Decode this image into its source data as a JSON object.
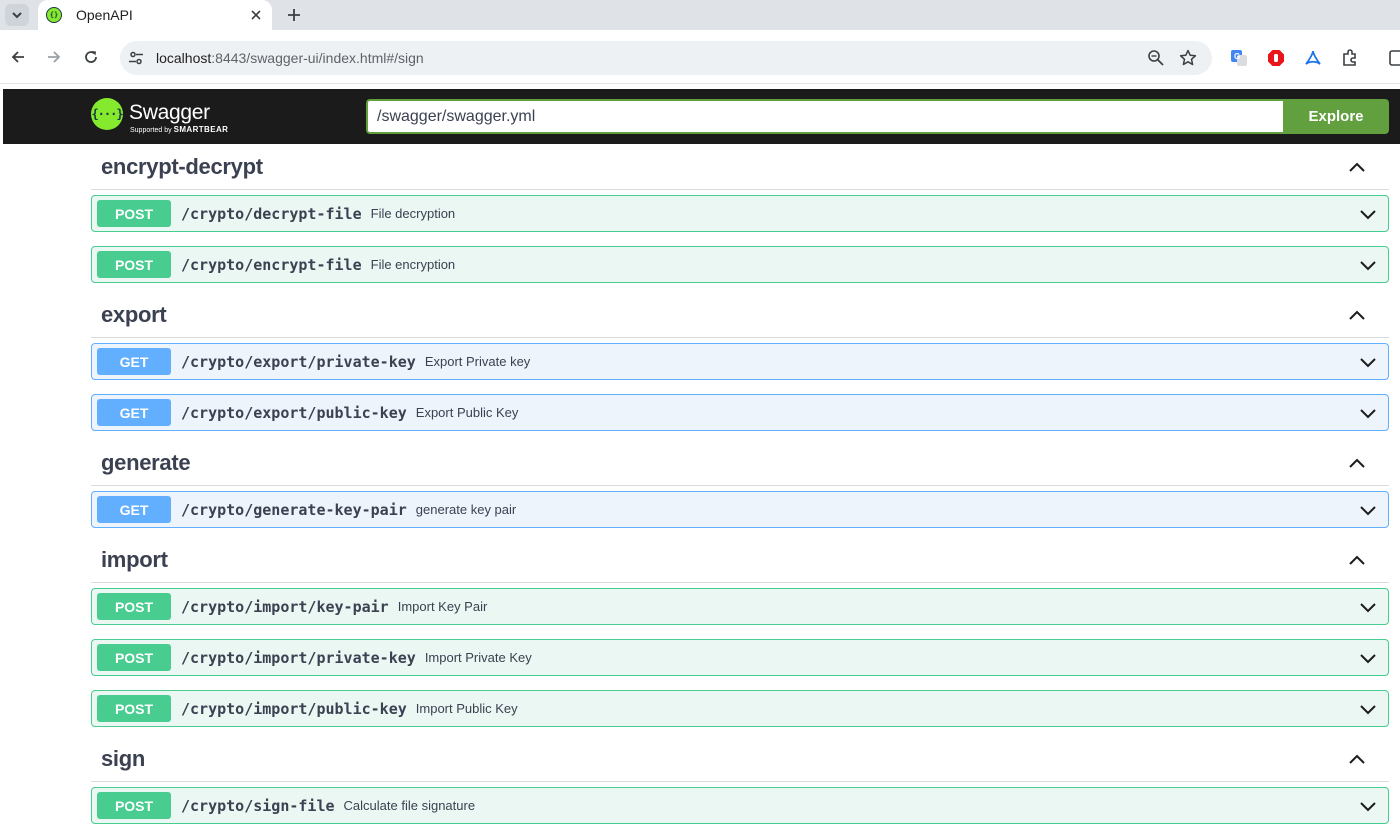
{
  "browser": {
    "tab_title": "OpenAPI",
    "url_host": "localhost",
    "url_rest": ":8443/swagger-ui/index.html#/sign"
  },
  "swagger": {
    "logo_text": "Swagger",
    "logo_sub_prefix": "Supported by",
    "logo_sub_brand": "SMARTBEAR",
    "spec_url": "/swagger/swagger.yml",
    "explore_label": "Explore"
  },
  "sections": [
    {
      "title": "encrypt-decrypt",
      "ops": [
        {
          "method": "POST",
          "path": "/crypto/decrypt-file",
          "summary": "File decryption"
        },
        {
          "method": "POST",
          "path": "/crypto/encrypt-file",
          "summary": "File encryption"
        }
      ]
    },
    {
      "title": "export",
      "ops": [
        {
          "method": "GET",
          "path": "/crypto/export/private-key",
          "summary": "Export Private key"
        },
        {
          "method": "GET",
          "path": "/crypto/export/public-key",
          "summary": "Export Public Key"
        }
      ]
    },
    {
      "title": "generate",
      "ops": [
        {
          "method": "GET",
          "path": "/crypto/generate-key-pair",
          "summary": "generate key pair"
        }
      ]
    },
    {
      "title": "import",
      "ops": [
        {
          "method": "POST",
          "path": "/crypto/import/key-pair",
          "summary": "Import Key Pair"
        },
        {
          "method": "POST",
          "path": "/crypto/import/private-key",
          "summary": "Import Private Key"
        },
        {
          "method": "POST",
          "path": "/crypto/import/public-key",
          "summary": "Import Public Key"
        }
      ]
    },
    {
      "title": "sign",
      "ops": [
        {
          "method": "POST",
          "path": "/crypto/sign-file",
          "summary": "Calculate file signature"
        }
      ]
    }
  ],
  "colors": {
    "post": "#49cc90",
    "get": "#61affe",
    "swagger_green": "#62a03f",
    "topbar": "#1b1b1b"
  },
  "icons": {
    "section_toggle": "chevron-up-icon",
    "operation_toggle": "chevron-down-icon"
  }
}
